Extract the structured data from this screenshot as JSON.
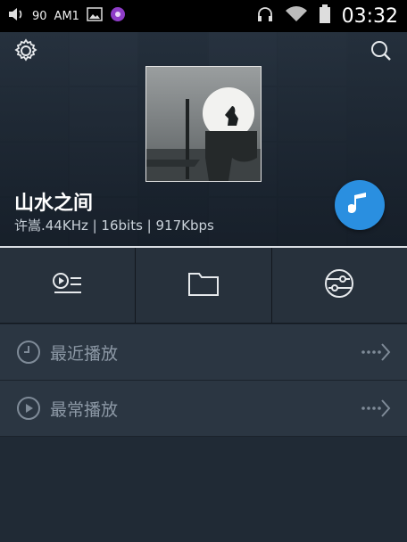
{
  "status_bar": {
    "volume_value": "90",
    "carrier": "AM1",
    "time": "03:32",
    "icons": [
      "volume-icon",
      "image-icon",
      "media-icon",
      "headphones-icon",
      "wifi-icon",
      "battery-icon"
    ]
  },
  "header": {
    "settings_icon": "gear-icon",
    "search_icon": "search-icon",
    "track_title": "山水之间",
    "track_info": "许嵩.44KHz | 16bits | 917Kbps",
    "play_button_icon": "music-note-icon"
  },
  "actions": [
    {
      "name": "playlist",
      "icon": "playlist-icon"
    },
    {
      "name": "folder",
      "icon": "folder-icon"
    },
    {
      "name": "equalizer",
      "icon": "equalizer-icon"
    }
  ],
  "list": [
    {
      "label": "最近播放",
      "icon": "clock-icon"
    },
    {
      "label": "最常播放",
      "icon": "play-circle-icon"
    }
  ],
  "colors": {
    "accent": "#2a8fe0",
    "background": "#1e2833",
    "row_bg": "#2b3642",
    "label_gray": "#8c98a5"
  }
}
